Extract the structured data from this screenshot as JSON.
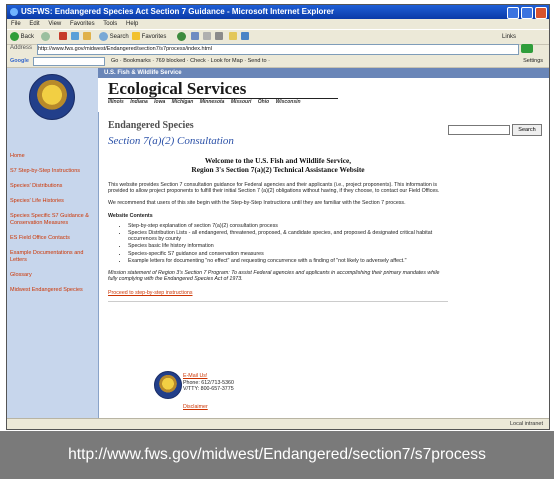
{
  "window": {
    "title": "USFWS: Endangered Species Act Section 7 Guidance - Microsoft Internet Explorer"
  },
  "menu": [
    "File",
    "Edit",
    "View",
    "Favorites",
    "Tools",
    "Help"
  ],
  "toolbar": {
    "back": "Back",
    "search": "Search",
    "favorites": "Favorites",
    "links": "Links"
  },
  "address": {
    "label": "Address",
    "url": "http://www.fws.gov/midwest/Endangered/section7/s7process/index.html"
  },
  "googlebar": {
    "brand": "Google",
    "items": "Go · Bookmarks · 769 blocked · Check · Look for Map · Send to ·",
    "settings": "Settings"
  },
  "site": {
    "agency": "U.S. Fish & Wildlife Service",
    "program": "Ecological Services",
    "states": [
      "Illinois",
      "Indiana",
      "Iowa",
      "Michigan",
      "Minnesota",
      "Missouri",
      "Ohio",
      "Wisconsin"
    ],
    "search_button": "Search"
  },
  "sidebar": {
    "items": [
      "Home",
      "S7 Step-by-Step Instructions",
      "Species' Distributions",
      "Species' Life Histories",
      "Species Specific S7 Guidance & Conservation Measures",
      "ES Field Office Contacts",
      "Example Documentations and Letters",
      "Glossary",
      "Midwest Endangered Species"
    ]
  },
  "main": {
    "heading": "Endangered Species",
    "subheading": "Section 7(a)(2) Consultation",
    "welcome_line1": "Welcome to the U.S. Fish and Wildlife Service,",
    "welcome_line2": "Region 3's Section 7(a)(2) Technical Assistance Website",
    "para1": "This website provides Section 7 consultation guidance for Federal agencies and their applicants (i.e., project proponents). This information is provided to allow project proponents to fulfill their initial Section 7 (a)(2) obligations without having, if they choose, to contact our Field Offices.",
    "para2": "We recommend that users of this site begin with the Step-by-Step Instructions until they are familiar with the Section 7 process.",
    "contents_heading": "Website Contents",
    "contents": [
      "Step-by-step explanation of section 7(a)(2) consultation process",
      "Species Distribution Lists - all endangered, threatened, proposed, & candidate species, and proposed & designated critical habitat occurrences by county",
      "Species basic life history information",
      "Species-specific S7 guidance and conservation measures",
      "Example letters for documenting \"no effect\" and requesting concurrence with a finding of \"not likely to adversely affect.\""
    ],
    "mission": "Mission statement of Region 3's Section 7 Program: To assist Federal agencies and applicants in accomplishing their primary mandates while fully complying with the Endangered Species Act of 1973.",
    "proceed_link": "Proceed to step-by-step instructions",
    "contact_email": "E-Mail Us!",
    "contact_phone": "Phone: 612/713-5360",
    "contact_tty": "V/TTY: 800-657-3775",
    "disclaimer": "Disclaimer"
  },
  "status": {
    "zone": "Local intranet"
  },
  "caption": "http://www.fws.gov/midwest/Endangered/section7/s7process",
  "colors": {
    "titlebar": "#0a3aa8",
    "sidebar_bg": "#c7d6ec",
    "link": "#cc3300",
    "subheading": "#2b51a8",
    "caption_bg": "#7a7a7a"
  }
}
